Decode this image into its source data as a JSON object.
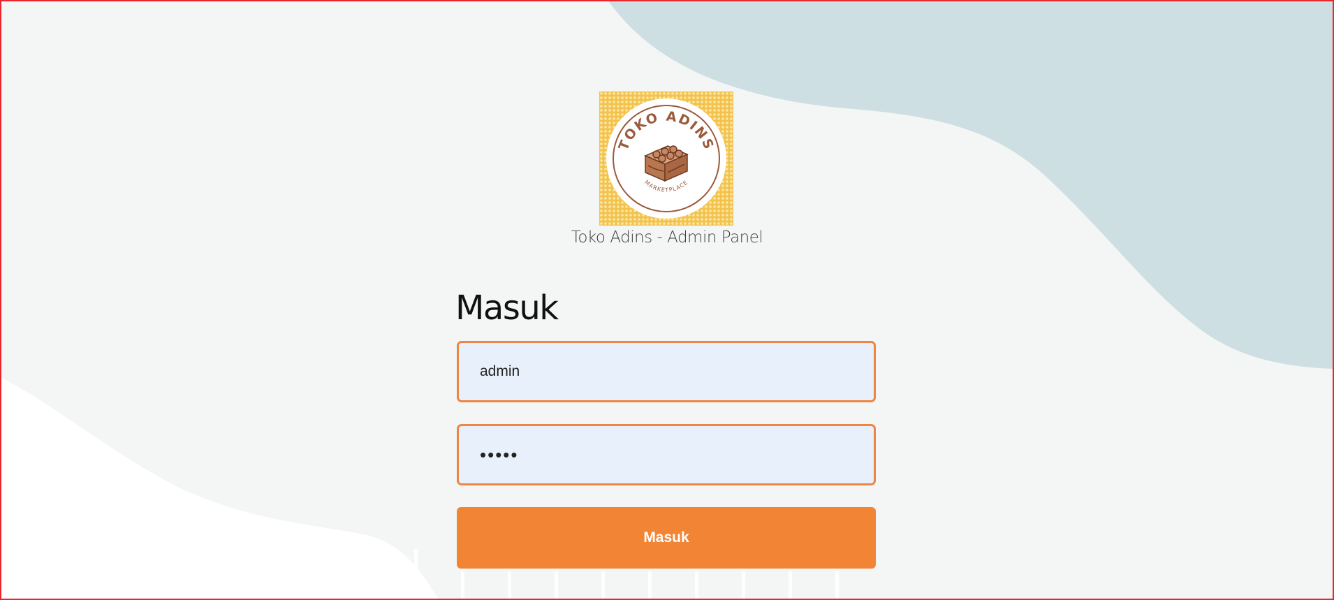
{
  "app": {
    "caption": "Toko Adins - Admin Panel"
  },
  "logo": {
    "alt": "Toko Adins Marketplace logo",
    "title": "TOKO ADINS",
    "subtitle": "MARKETPLACE",
    "icon": "cake-box-icon"
  },
  "login": {
    "heading": "Masuk",
    "username_value": "admin",
    "password_value": "admin",
    "submit_label": "Masuk"
  },
  "colors": {
    "accent": "#f28535",
    "input_border": "#ee8542",
    "input_fill": "#e8f0fb",
    "background": "#f4f6f5",
    "blob": "#cddfe3",
    "logo_bg": "#f7d67a",
    "logo_brown": "#9a5a3c"
  }
}
